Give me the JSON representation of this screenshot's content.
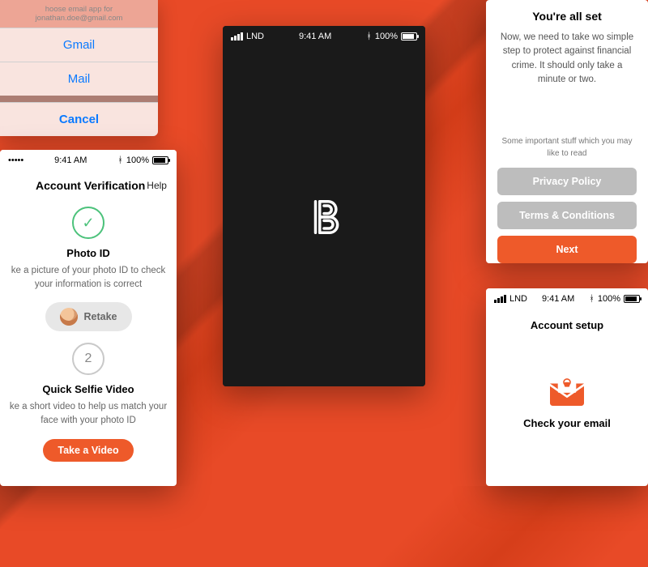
{
  "colors": {
    "accent": "#ee5a2a",
    "dark": "#1a1a1a"
  },
  "status": {
    "carrier": "LND",
    "time": "9:41 AM",
    "battery": "100%"
  },
  "sheet": {
    "hint": "hoose email app for jonathan.doe@gmail.com",
    "options": [
      "Gmail",
      "Mail"
    ],
    "cancel": "Cancel"
  },
  "verify": {
    "title": "Account Verification",
    "help": "Help",
    "step1": {
      "heading": "Photo ID",
      "body": "ke a picture of your photo ID to check your information is correct",
      "button": "Retake",
      "status_icon": "check"
    },
    "step2": {
      "number": "2",
      "heading": "Quick Selfie Video",
      "body": "ke a short video to help us match your face with your photo ID",
      "button": "Take a Video"
    }
  },
  "splash": {
    "logo_label": "B"
  },
  "allset": {
    "title": "You're all set",
    "body": "Now, we need to take wo simple step to protect against financial crime. It should only take a minute or two.",
    "smallprint": "Some important stuff which you may like to read",
    "privacy": "Privacy Policy",
    "terms": "Terms & Conditions",
    "next": "Next"
  },
  "setup": {
    "title": "Account setup",
    "heading": "Check your email"
  }
}
